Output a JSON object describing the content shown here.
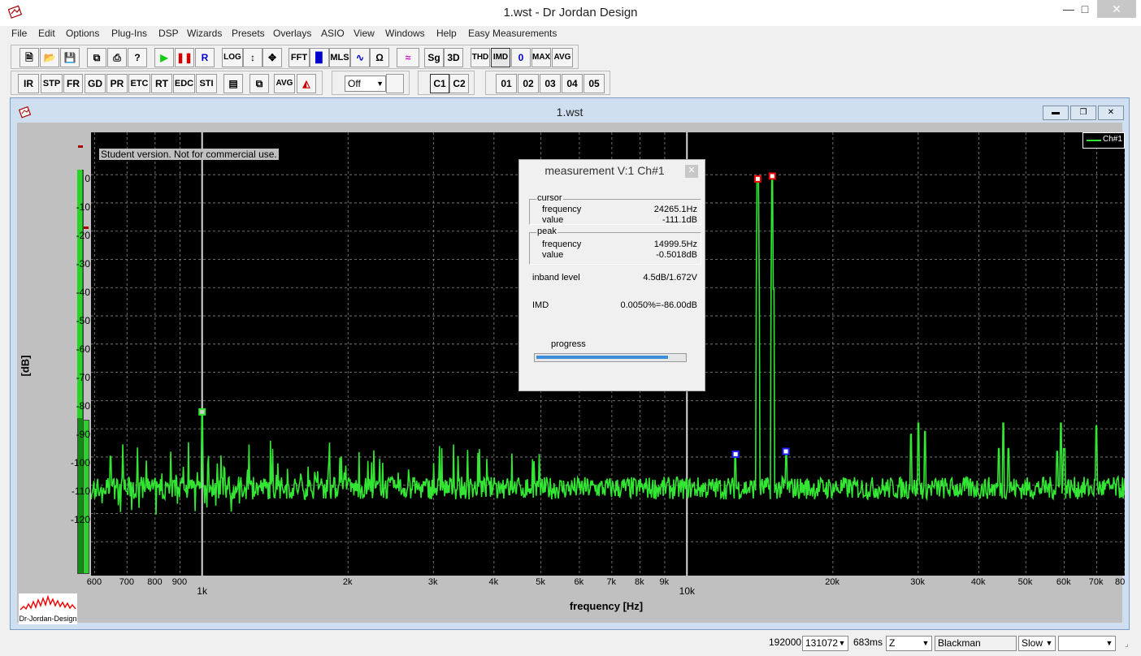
{
  "window": {
    "title": "1.wst - Dr Jordan Design"
  },
  "menu": [
    "File",
    "Edit",
    "Options",
    "Plug-Ins",
    "DSP",
    "Wizards",
    "Presets",
    "Overlays",
    "ASIO",
    "View",
    "Windows",
    "Help",
    "Easy Measurements"
  ],
  "toolbar1": {
    "file_buttons": [
      "new-doc-icon",
      "open-folder-icon",
      "save-icon"
    ],
    "edit_buttons": [
      "copy-icon",
      "print-icon",
      "help-icon"
    ],
    "run_buttons": [
      "play-icon",
      "pause-icon"
    ],
    "r_label": "R",
    "log_label": "LOG",
    "zoom_buttons": [
      "vertical-arrow-icon",
      "move-arrows-icon"
    ],
    "fft_label": "FFT",
    "mls_label": "MLS",
    "sg_label": "Sg",
    "three_d_label": "3D",
    "thd_label": "THD",
    "imd_label": "IMD",
    "zero_label": "0",
    "max_label": "MAX",
    "avg_label": "AVG"
  },
  "toolbar2": {
    "analysis_buttons": [
      "IR",
      "STP",
      "FR",
      "GD",
      "PR",
      "ETC",
      "RT",
      "EDC",
      "STI"
    ],
    "avg_label": "AVG",
    "select_value": "Off",
    "channel_buttons": [
      "C1",
      "C2"
    ],
    "overlay_buttons": [
      "01",
      "02",
      "03",
      "04",
      "05"
    ]
  },
  "document": {
    "title": "1.wst",
    "student_notice": "Student version. Not for commercial use.",
    "logo_label": "Dr-Jordan-Design"
  },
  "chart_data": {
    "type": "line",
    "xlabel": "frequency [Hz]",
    "ylabel": "[dB]",
    "x_scale": "log",
    "xlim": [
      590,
      80000
    ],
    "ylim": [
      -142,
      15
    ],
    "y_ticks": [
      "0",
      "-10",
      "-20",
      "-30",
      "-40",
      "-50",
      "-60",
      "-70",
      "-80",
      "-90",
      "-100",
      "-110",
      "-120"
    ],
    "x_ticks": [
      "600",
      "700",
      "800",
      "900",
      "1k",
      "2k",
      "3k",
      "4k",
      "5k",
      "6k",
      "7k",
      "8k",
      "9k",
      "10k",
      "20k",
      "30k",
      "40k",
      "50k",
      "60k",
      "70k",
      "80"
    ],
    "legend": [
      "Ch#1"
    ],
    "legend_position": "top-right",
    "grid": true,
    "series_color": "#33e633",
    "noise_floor_db": -111,
    "peaks": [
      {
        "x": 1000,
        "y": -84
      },
      {
        "x": 12600,
        "y": -99
      },
      {
        "x": 14000,
        "y": -1
      },
      {
        "x": 14999.5,
        "y": -0.5
      },
      {
        "x": 16000,
        "y": -98
      },
      {
        "x": 29000,
        "y": -92
      },
      {
        "x": 30000,
        "y": -88
      },
      {
        "x": 31000,
        "y": -91
      },
      {
        "x": 44000,
        "y": -97
      },
      {
        "x": 45000,
        "y": -88
      },
      {
        "x": 46000,
        "y": -97
      },
      {
        "x": 58000,
        "y": -98
      },
      {
        "x": 59000,
        "y": -88
      },
      {
        "x": 60000,
        "y": -97
      },
      {
        "x": 70000,
        "y": -89
      }
    ],
    "cursor_x": 1000,
    "marker_x": 10000
  },
  "measurement_dialog": {
    "title": "measurement V:1 Ch#1",
    "cursor_label": "cursor",
    "cursor_frequency_label": "frequency",
    "cursor_frequency": "24265.1Hz",
    "cursor_value_label": "value",
    "cursor_value": "-111.1dB",
    "peak_label": "peak",
    "peak_frequency_label": "frequency",
    "peak_frequency": "14999.5Hz",
    "peak_value_label": "value",
    "peak_value": "-0.5018dB",
    "inband_label": "inband level",
    "inband_value": "4.5dB/1.672V",
    "imd_label": "IMD",
    "imd_value": "0.0050%=-86.00dB",
    "progress_label": "progress",
    "progress": 0.9
  },
  "status": {
    "rate": "192000",
    "fft_size": "131072",
    "duration": "683ms",
    "weighting": "Z",
    "window": "Blackman",
    "speed": "Slow",
    "extra": ""
  }
}
